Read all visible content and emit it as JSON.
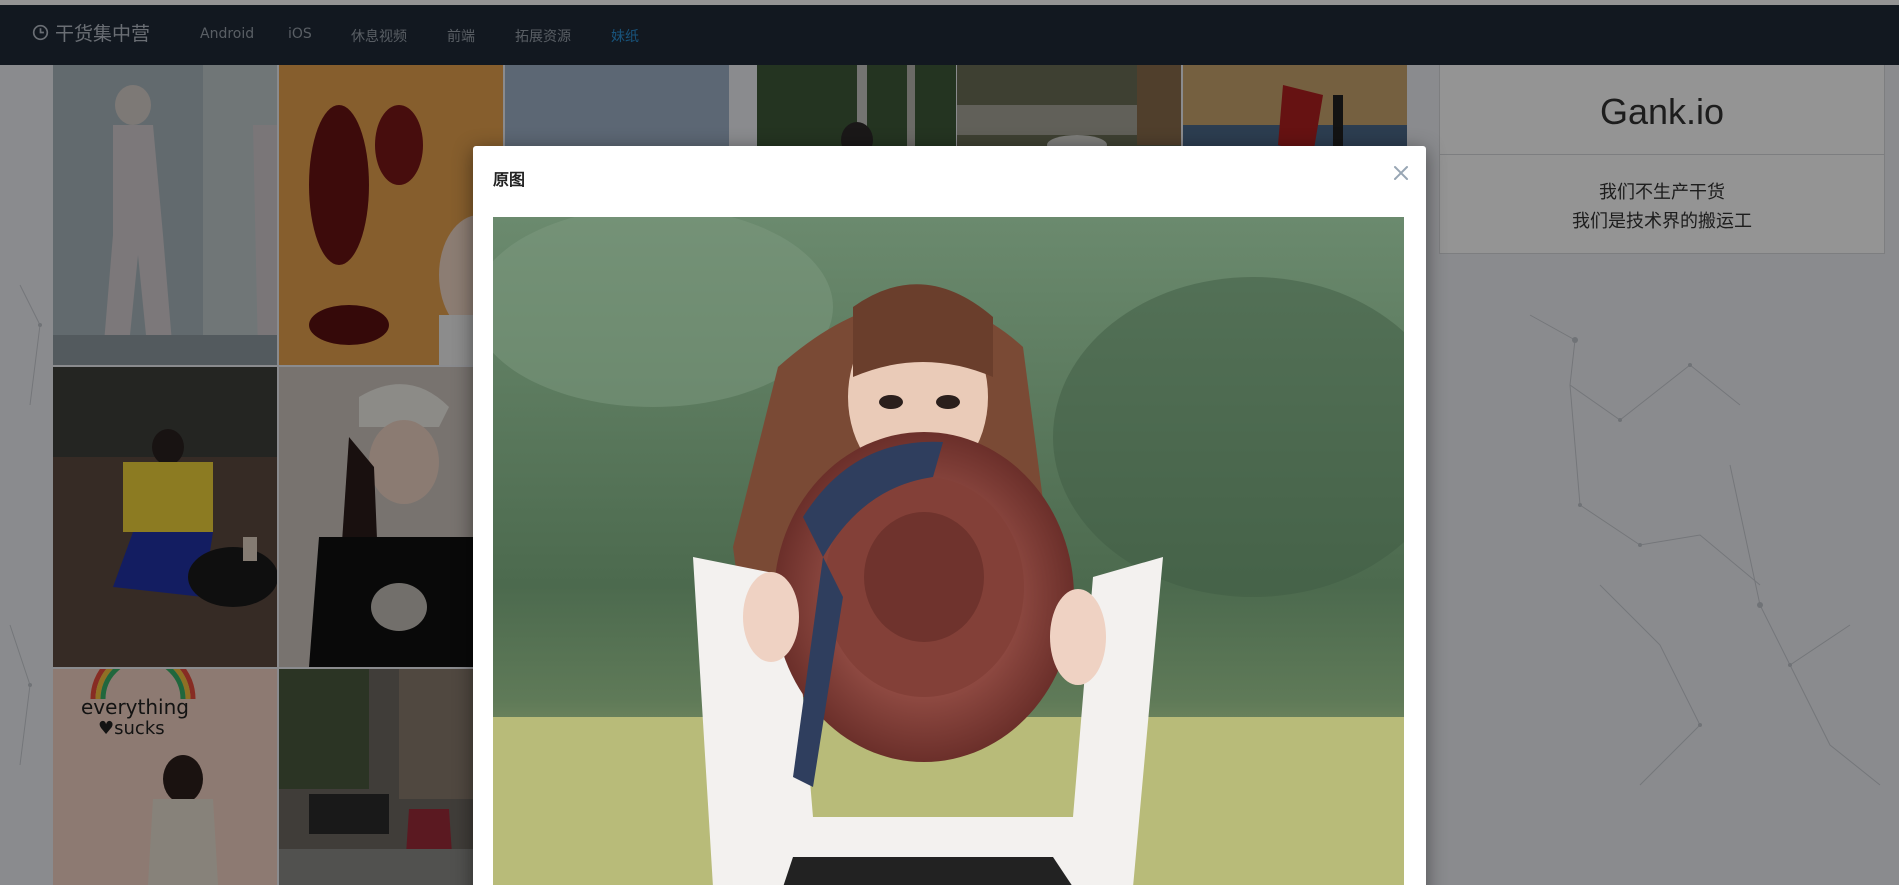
{
  "navbar": {
    "brand": "干货集中营",
    "items": [
      {
        "label": "Android"
      },
      {
        "label": "iOS"
      },
      {
        "label": "休息视频"
      },
      {
        "label": "前端"
      },
      {
        "label": "拓展资源"
      },
      {
        "label": "妹纸",
        "active": true
      }
    ]
  },
  "sidebar": {
    "title": "Gank.io",
    "slogan_line1": "我们不生产干货",
    "slogan_line2": "我们是技术界的搬运工"
  },
  "modal": {
    "title": "原图",
    "close_icon": "close-icon"
  },
  "colors": {
    "navbar_bg": "#1f2a38",
    "active_link": "#2a8fd4",
    "overlay": "rgba(0,0,0,0.42)"
  }
}
